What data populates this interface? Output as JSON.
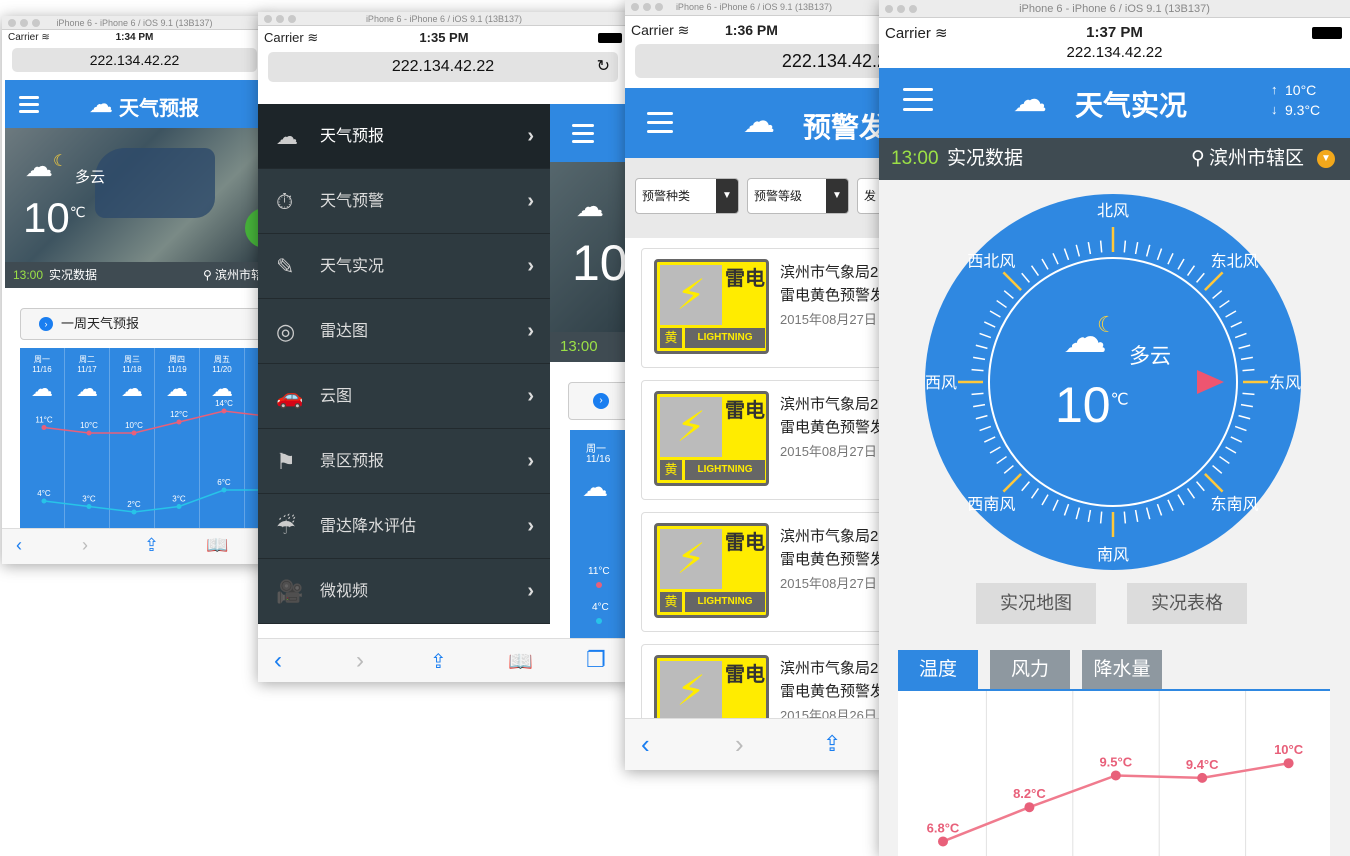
{
  "screens": {
    "s1": {
      "chrome_title": "iPhone 6 - iPhone 6 / iOS 9.1 (13B137)",
      "carrier": "Carrier",
      "time": "1:34 PM",
      "url": "222.134.42.22",
      "title": "天气预报",
      "weather": "多云",
      "temp": "10",
      "unit": "℃",
      "obs_time": "13:00",
      "obs_label": "实况数据",
      "location": "滨州市辖",
      "weekly_btn": "一周天气预报",
      "days": [
        {
          "day": "周一",
          "date": "11/16",
          "high": "11°C",
          "low": "4°C"
        },
        {
          "day": "周二",
          "date": "11/17",
          "high": "10°C",
          "low": "3°C"
        },
        {
          "day": "周三",
          "date": "11/18",
          "high": "10°C",
          "low": "2°C"
        },
        {
          "day": "周四",
          "date": "11/19",
          "high": "12°C",
          "low": "3°C"
        },
        {
          "day": "周五",
          "date": "11/20",
          "high": "14°C",
          "low": "6°C"
        }
      ]
    },
    "s2": {
      "chrome_title": "iPhone 6 - iPhone 6 / iOS 9.1 (13B137)",
      "carrier": "Carrier",
      "time": "1:35 PM",
      "url": "222.134.42.22",
      "menu": [
        {
          "label": "天气预报",
          "icon": "cloud-icon",
          "glyph": "☁"
        },
        {
          "label": "天气预警",
          "icon": "stopwatch-icon",
          "glyph": "⏱"
        },
        {
          "label": "天气实况",
          "icon": "edit-icon",
          "glyph": "✎"
        },
        {
          "label": "雷达图",
          "icon": "radar-icon",
          "glyph": "◎"
        },
        {
          "label": "云图",
          "icon": "car-icon",
          "glyph": "🚗"
        },
        {
          "label": "景区预报",
          "icon": "signpost-icon",
          "glyph": "⚑"
        },
        {
          "label": "雷达降水评估",
          "icon": "rain-icon",
          "glyph": "☔"
        },
        {
          "label": "微视频",
          "icon": "video-camera-icon",
          "glyph": "🎥"
        }
      ],
      "peek_temp": "10",
      "peek_obs": "13:00",
      "peek_day": "周一",
      "peek_date": "11/16",
      "peek_high": "11°C",
      "peek_low": "4°C"
    },
    "s3": {
      "chrome_title": "iPhone 6 - iPhone 6 / iOS 9.1 (13B137)",
      "carrier": "Carrier",
      "time": "1:36 PM",
      "url": "222.134.42.2",
      "title": "预警发",
      "filter_type": "预警种类",
      "filter_level": "预警等级",
      "filter_pub": "发",
      "sign_huang": "黄",
      "sign_lightning": "LIGHTNING",
      "sign_lei": "雷电",
      "alerts": [
        {
          "line1": "滨州市气象局2",
          "line2": "雷电黄色预警发",
          "date": "2015年08月27日"
        },
        {
          "line1": "滨州市气象局2",
          "line2": "雷电黄色预警发",
          "date": "2015年08月27日"
        },
        {
          "line1": "滨州市气象局2",
          "line2": "雷电黄色预警发",
          "date": "2015年08月27日"
        },
        {
          "line1": "滨州市气象局2",
          "line2": "雷电黄色预警发",
          "date": "2015年08月26日"
        }
      ]
    },
    "s4": {
      "chrome_title": "iPhone 6 - iPhone 6 / iOS 9.1 (13B137)",
      "carrier": "Carrier",
      "time": "1:37 PM",
      "url": "222.134.42.22",
      "title": "天气实况",
      "max_temp": "10°C",
      "min_temp": "9.3°C",
      "obs_time": "13:00",
      "obs_label": "实况数据",
      "location": "滨州市辖区",
      "weather": "多云",
      "temp": "10",
      "unit": "℃",
      "compass": {
        "n": "北风",
        "ne": "东北风",
        "e": "东风",
        "se": "东南风",
        "s": "南风",
        "sw": "西南风",
        "w": "西风",
        "nw": "西北风"
      },
      "btn_map": "实况地图",
      "btn_table": "实况表格",
      "tabs": [
        "温度",
        "风力",
        "降水量"
      ],
      "chart_data": {
        "type": "line",
        "series": [
          {
            "values": [
              6.8,
              8.2,
              9.5,
              9.4,
              10.0
            ]
          }
        ],
        "labels": [
          "6.8°C",
          "8.2°C",
          "9.5°C",
          "9.4°C",
          "10°C"
        ]
      }
    }
  },
  "colors": {
    "blue": "#2f88e1",
    "dark": "#3f4b52",
    "green_time": "#9be046",
    "line_high": "#e8607a",
    "line_low": "#27c4e8"
  }
}
